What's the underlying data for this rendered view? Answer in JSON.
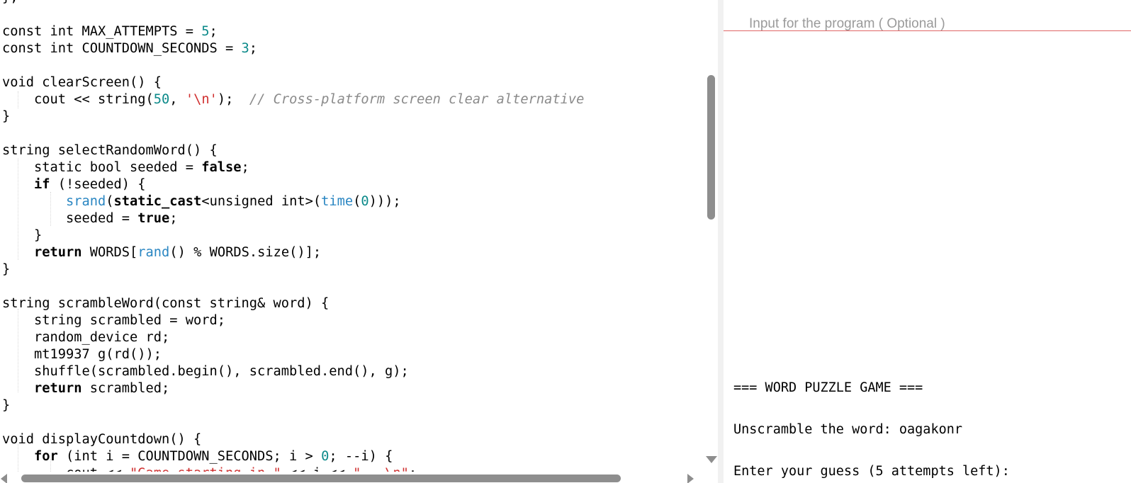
{
  "editor": {
    "lines": [
      [
        {
          "t": "};",
          "c": "plain"
        }
      ],
      [
        {
          "t": "",
          "c": "plain"
        }
      ],
      [
        {
          "t": "const int MAX_ATTEMPTS = ",
          "c": "plain"
        },
        {
          "t": "5",
          "c": "num"
        },
        {
          "t": ";",
          "c": "plain"
        }
      ],
      [
        {
          "t": "const int COUNTDOWN_SECONDS = ",
          "c": "plain"
        },
        {
          "t": "3",
          "c": "num"
        },
        {
          "t": ";",
          "c": "plain"
        }
      ],
      [
        {
          "t": "",
          "c": "plain"
        }
      ],
      [
        {
          "t": "void clearScreen() {",
          "c": "plain"
        }
      ],
      [
        {
          "t": "    cout << string(",
          "c": "plain"
        },
        {
          "t": "50",
          "c": "num"
        },
        {
          "t": ", ",
          "c": "plain"
        },
        {
          "t": "'\\n'",
          "c": "str"
        },
        {
          "t": ");  ",
          "c": "plain"
        },
        {
          "t": "// Cross-platform screen clear alternative",
          "c": "cmt"
        }
      ],
      [
        {
          "t": "}",
          "c": "plain"
        }
      ],
      [
        {
          "t": "",
          "c": "plain"
        }
      ],
      [
        {
          "t": "string selectRandomWord() {",
          "c": "plain"
        }
      ],
      [
        {
          "t": "    static bool seeded = ",
          "c": "plain"
        },
        {
          "t": "false",
          "c": "bold"
        },
        {
          "t": ";",
          "c": "plain"
        }
      ],
      [
        {
          "t": "    ",
          "c": "plain"
        },
        {
          "t": "if",
          "c": "bold"
        },
        {
          "t": " (!seeded) {",
          "c": "plain"
        }
      ],
      [
        {
          "t": "        ",
          "c": "plain"
        },
        {
          "t": "srand",
          "c": "fn"
        },
        {
          "t": "(",
          "c": "plain"
        },
        {
          "t": "static_cast",
          "c": "bold"
        },
        {
          "t": "<unsigned int>(",
          "c": "plain"
        },
        {
          "t": "time",
          "c": "fn"
        },
        {
          "t": "(",
          "c": "plain"
        },
        {
          "t": "0",
          "c": "num"
        },
        {
          "t": ")));",
          "c": "plain"
        }
      ],
      [
        {
          "t": "        seeded = ",
          "c": "plain"
        },
        {
          "t": "true",
          "c": "bold"
        },
        {
          "t": ";",
          "c": "plain"
        }
      ],
      [
        {
          "t": "    }",
          "c": "plain"
        }
      ],
      [
        {
          "t": "    ",
          "c": "plain"
        },
        {
          "t": "return",
          "c": "bold"
        },
        {
          "t": " WORDS[",
          "c": "plain"
        },
        {
          "t": "rand",
          "c": "fn"
        },
        {
          "t": "() % WORDS.size()];",
          "c": "plain"
        }
      ],
      [
        {
          "t": "}",
          "c": "plain"
        }
      ],
      [
        {
          "t": "",
          "c": "plain"
        }
      ],
      [
        {
          "t": "string scrambleWord(const string& word) {",
          "c": "plain"
        }
      ],
      [
        {
          "t": "    string scrambled = word;",
          "c": "plain"
        }
      ],
      [
        {
          "t": "    random_device rd;",
          "c": "plain"
        }
      ],
      [
        {
          "t": "    mt19937 g(rd());",
          "c": "plain"
        }
      ],
      [
        {
          "t": "    shuffle(scrambled.begin(), scrambled.end(), g);",
          "c": "plain"
        }
      ],
      [
        {
          "t": "    ",
          "c": "plain"
        },
        {
          "t": "return",
          "c": "bold"
        },
        {
          "t": " scrambled;",
          "c": "plain"
        }
      ],
      [
        {
          "t": "}",
          "c": "plain"
        }
      ],
      [
        {
          "t": "",
          "c": "plain"
        }
      ],
      [
        {
          "t": "void displayCountdown() {",
          "c": "plain"
        }
      ],
      [
        {
          "t": "    ",
          "c": "plain"
        },
        {
          "t": "for",
          "c": "bold"
        },
        {
          "t": " (int i = COUNTDOWN_SECONDS; i > ",
          "c": "plain"
        },
        {
          "t": "0",
          "c": "num"
        },
        {
          "t": "; --i) {",
          "c": "plain"
        }
      ],
      [
        {
          "t": "        cout << ",
          "c": "plain"
        },
        {
          "t": "\"Game starting in \"",
          "c": "str"
        },
        {
          "t": " << i << ",
          "c": "plain"
        },
        {
          "t": "\"...\\n\"",
          "c": "str"
        },
        {
          "t": ";",
          "c": "plain"
        }
      ]
    ]
  },
  "program_input": {
    "placeholder": "Input for the program ( Optional )",
    "value": ""
  },
  "output": {
    "lines": [
      "=== WORD PUZZLE GAME ===",
      "",
      "Unscramble the word: oagakonr",
      "",
      "Enter your guess (5 attempts left):"
    ]
  },
  "colors": {
    "keyword_bold": "#000000",
    "number": "#0c8a8a",
    "string": "#d02f2f",
    "function": "#2a86c2",
    "comment": "#8a8a8a",
    "input_underline": "#e06666",
    "scrollbar": "#8e8e8e"
  },
  "icons": [
    "scroll-down-arrow-icon",
    "scroll-left-arrow-icon",
    "scroll-right-arrow-icon"
  ]
}
